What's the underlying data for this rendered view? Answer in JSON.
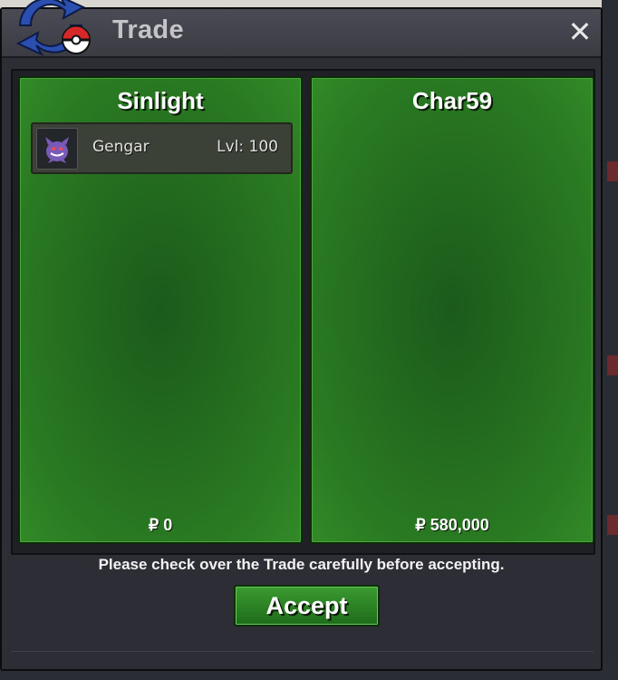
{
  "window": {
    "title": "Trade",
    "close_label": "✕"
  },
  "panels": [
    {
      "owner": "Sinlight",
      "money": "₽ 0",
      "items": [
        {
          "name": "Gengar",
          "level": "Lvl: 100",
          "icon": "gengar-sprite"
        }
      ]
    },
    {
      "owner": "Char59",
      "money": "₽ 580,000",
      "items": []
    }
  ],
  "notice": "Please check over the Trade carefully before accepting.",
  "accept_label": "Accept",
  "colors": {
    "panel_green": "#2a7a22",
    "window_bg": "#2d2e35",
    "accept_green": "#3b9b30"
  }
}
